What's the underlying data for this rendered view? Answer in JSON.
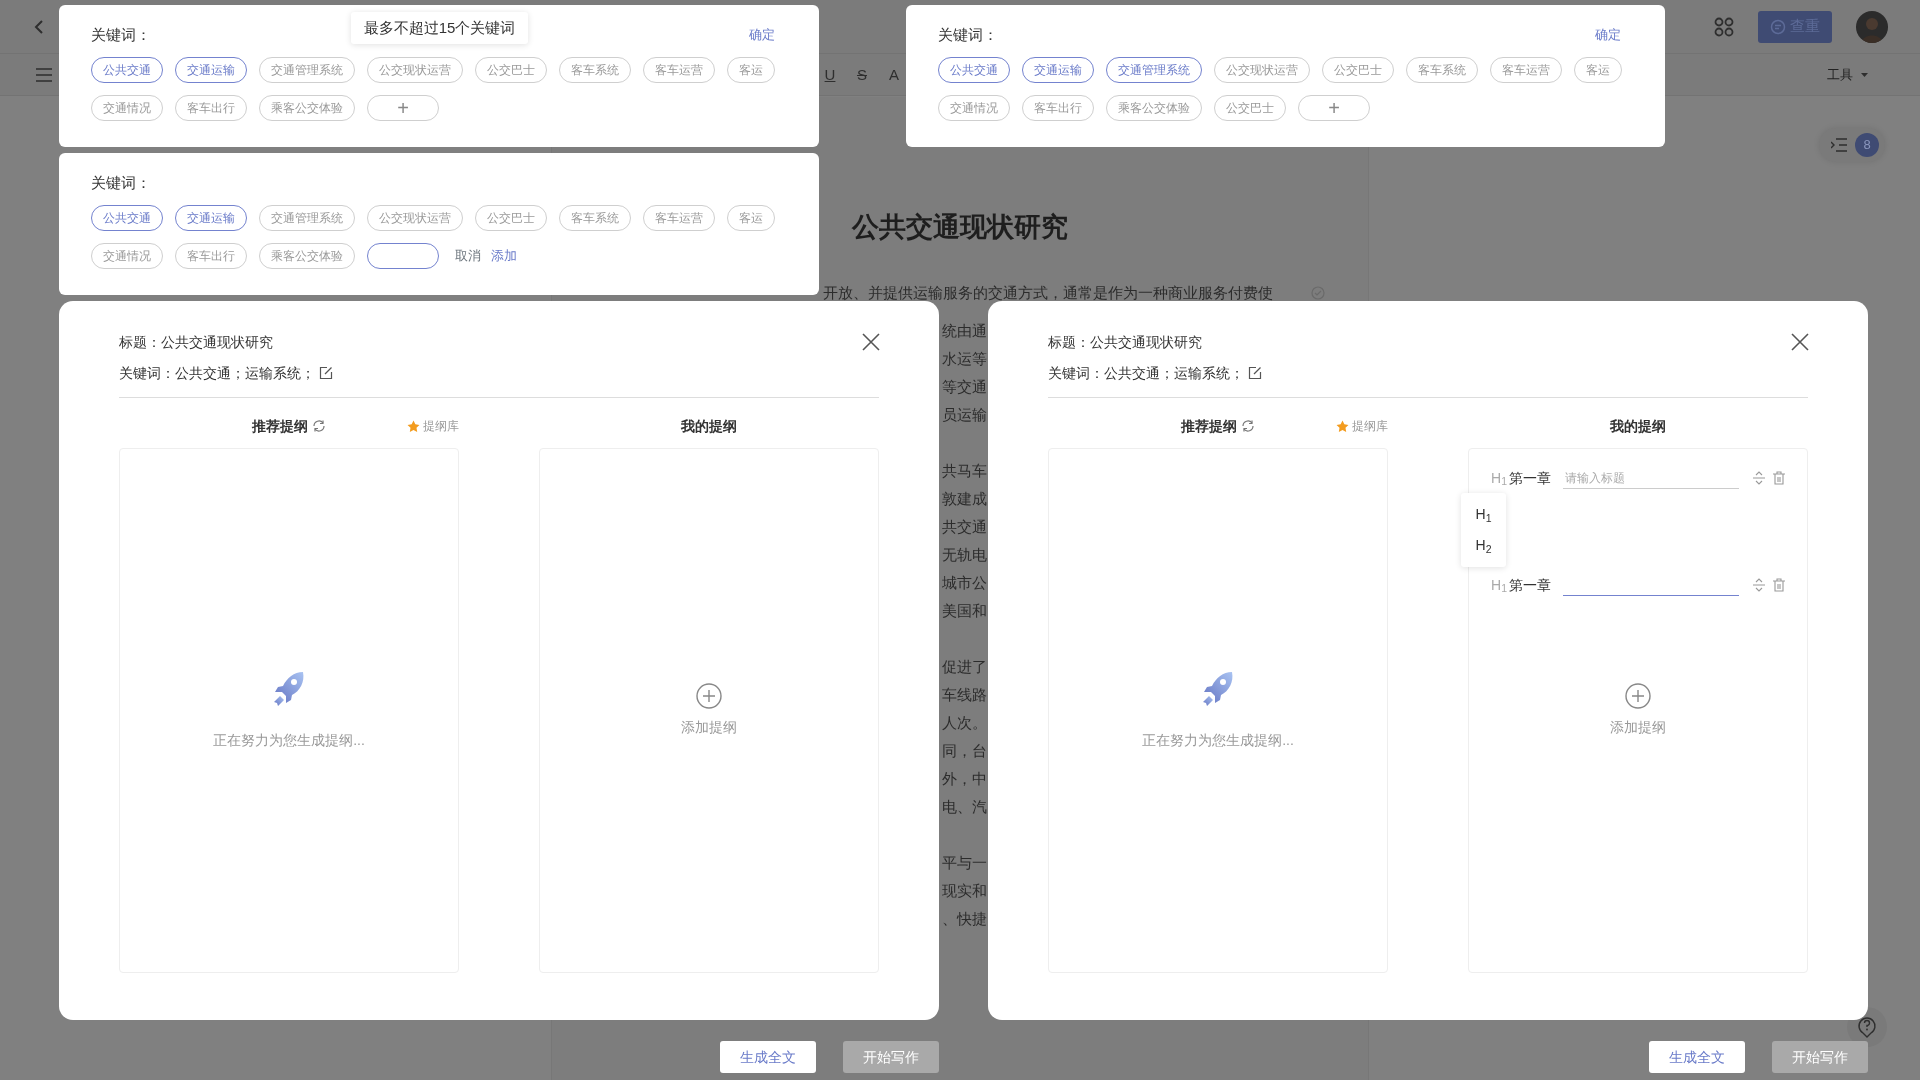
{
  "app": {
    "format_buttons": [
      {
        "label": "U",
        "kind": "underline"
      },
      {
        "label": "S",
        "kind": "strike"
      },
      {
        "label": "A",
        "kind": "font"
      }
    ],
    "check_button": "查重",
    "tools_menu": "工具",
    "outline_count": "8",
    "doc_title": "公共交通现状研究",
    "doc_first_line": "开放、并提供运输服务的交通方式，通常是作为一种商业服务付费使",
    "doc_fragments": [
      [
        "统由通",
        "水运等",
        "等交通",
        "员运输"
      ],
      [
        "共马车",
        "敦建成",
        "共交通",
        "无轨电",
        "城市公",
        "美国和"
      ],
      [
        "促进了",
        "车线路",
        "人次。",
        "同，台",
        "外，中",
        "电、汽"
      ],
      [
        "平与一",
        "现实和",
        "、快捷"
      ]
    ]
  },
  "keyword_panels": [
    {
      "label": "关键词：",
      "confirm": "确定",
      "tooltip": "最多不超过15个关键词",
      "chips": [
        {
          "label": "公共交通",
          "selected": true
        },
        {
          "label": "交通运输",
          "selected": true
        },
        {
          "label": "交通管理系统",
          "selected": false
        },
        {
          "label": "公交现状运营",
          "selected": false
        },
        {
          "label": "公交巴士",
          "selected": false
        },
        {
          "label": "客车系统",
          "selected": false
        },
        {
          "label": "客车运营",
          "selected": false
        },
        {
          "label": "客运",
          "selected": false
        },
        {
          "label": "交通情况",
          "selected": false
        },
        {
          "label": "客车出行",
          "selected": false
        },
        {
          "label": "乘客公交体验",
          "selected": false
        }
      ],
      "adder": {
        "kind": "plus",
        "label": "+"
      }
    },
    {
      "label": "关键词：",
      "chips": [
        {
          "label": "公共交通",
          "selected": true
        },
        {
          "label": "交通运输",
          "selected": true
        },
        {
          "label": "交通管理系统",
          "selected": false
        },
        {
          "label": "公交现状运营",
          "selected": false
        },
        {
          "label": "公交巴士",
          "selected": false
        },
        {
          "label": "客车系统",
          "selected": false
        },
        {
          "label": "客车运营",
          "selected": false
        },
        {
          "label": "客运",
          "selected": false
        },
        {
          "label": "交通情况",
          "selected": false
        },
        {
          "label": "客车出行",
          "selected": false
        },
        {
          "label": "乘客公交体验",
          "selected": false
        }
      ],
      "adder": {
        "kind": "input",
        "cancel": "取消",
        "add": "添加"
      }
    },
    {
      "label": "关键词：",
      "confirm": "确定",
      "chips": [
        {
          "label": "公共交通",
          "selected": true
        },
        {
          "label": "交通运输",
          "selected": true
        },
        {
          "label": "交通管理系统",
          "selected": true
        },
        {
          "label": "公交现状运营",
          "selected": false
        },
        {
          "label": "公交巴士",
          "selected": false
        },
        {
          "label": "客车系统",
          "selected": false
        },
        {
          "label": "客车运营",
          "selected": false
        },
        {
          "label": "客运",
          "selected": false
        },
        {
          "label": "交通情况",
          "selected": false
        },
        {
          "label": "客车出行",
          "selected": false
        },
        {
          "label": "乘客公交体验",
          "selected": false
        },
        {
          "label": "公交巴士",
          "selected": false
        }
      ],
      "adder": {
        "kind": "plus",
        "label": "+"
      }
    }
  ],
  "dialogs": [
    {
      "title": "标题：公共交通现状研究",
      "keywords": "关键词：公共交通；运输系统；",
      "recommended": {
        "heading": "推荐提纲",
        "library": "提纲库",
        "loading": "正在努力为您生成提纲..."
      },
      "mine": {
        "heading": "我的提纲",
        "add": "添加提纲"
      },
      "footer": {
        "generate": "生成全文",
        "start": "开始写作",
        "start_disabled": true
      }
    },
    {
      "title": "标题：公共交通现状研究",
      "keywords": "关键词：公共交通；运输系统；",
      "recommended": {
        "heading": "推荐提纲",
        "library": "提纲库",
        "loading": "正在努力为您生成提纲..."
      },
      "mine": {
        "heading": "我的提纲",
        "add": "添加提纲",
        "rows": [
          {
            "level": "H$_{1}$",
            "chapter": "第一章",
            "placeholder": "请输入标题",
            "focused": false,
            "menu": [
              "H$_{1}$",
              "H$_{2}$"
            ]
          },
          {
            "level": "H$_{1}$",
            "chapter": "第一章",
            "focused": true
          }
        ]
      },
      "footer": {
        "generate": "生成全文",
        "start": "开始写作",
        "start_disabled": true
      }
    }
  ]
}
